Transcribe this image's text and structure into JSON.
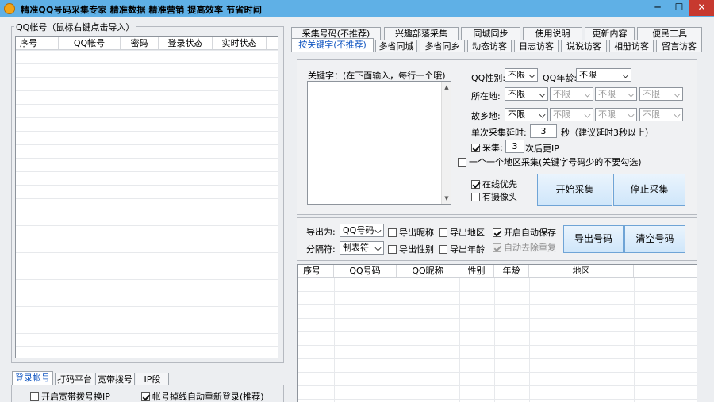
{
  "window": {
    "title": "精准QQ号码采集专家   精准数据 精准营销 提高效率 节省时间",
    "min": "─",
    "max": "☐",
    "close": "✕"
  },
  "left": {
    "group_title": "QQ帐号（鼠标右键点击导入）",
    "columns": [
      "序号",
      "QQ帐号",
      "密码",
      "登录状态",
      "实时状态"
    ],
    "bottom_tabs": [
      "登录帐号",
      "打码平台",
      "宽带拨号",
      "IP段"
    ],
    "opt_broadband": "开启宽带拨号换IP",
    "opt_relogin": "帐号掉线自动重新登录(推荐)"
  },
  "tabs_row1": [
    "采集号码(不推荐)",
    "兴趣部落采集",
    "同城同步",
    "使用说明",
    "更新内容",
    "便民工具"
  ],
  "tabs_row2": [
    "按关键字(不推荐)",
    "多省同城",
    "多省同乡",
    "动态访客",
    "日志访客",
    "说说访客",
    "相册访客",
    "留言访客"
  ],
  "search": {
    "keyword_label": "关键字：(在下面输入，每行一个哦)",
    "gender_label": "QQ性别:",
    "gender_value": "不限",
    "age_label": "QQ年龄:",
    "age_value": "不限",
    "location_label": "所在地:",
    "location_values": [
      "不限",
      "不限",
      "不限",
      "不限"
    ],
    "hometown_label": "故乡地:",
    "hometown_values": [
      "不限",
      "不限",
      "不限",
      "不限"
    ],
    "delay_label": "单次采集延时:",
    "delay_value": "3",
    "delay_unit": "秒（建议延时3秒以上）",
    "ip_prefix": "采集:",
    "ip_value": "3",
    "ip_suffix": "次后更IP",
    "region_one_by_one": "一个一个地区采集(关键字号码少的不要勾选)",
    "online_first": "在线优先",
    "has_camera": "有摄像头",
    "start_button": "开始采集",
    "stop_button": "停止采集"
  },
  "export": {
    "export_label": "导出为:",
    "export_value": "QQ号码",
    "sep_label": "分隔符:",
    "sep_value": "制表符",
    "nick": "导出昵称",
    "region": "导出地区",
    "gender": "导出性别",
    "age": "导出年龄",
    "autosave": "开启自动保存",
    "dedupe": "自动去除重复",
    "export_button": "导出号码",
    "clear_button": "清空号码"
  },
  "results": {
    "columns": [
      "序号",
      "QQ号码",
      "QQ昵称",
      "性别",
      "年龄",
      "地区"
    ]
  },
  "colors": {
    "titlebar": "#5fb0e6",
    "active_tab_text": "#1458c2",
    "close_button": "#c7392f"
  }
}
